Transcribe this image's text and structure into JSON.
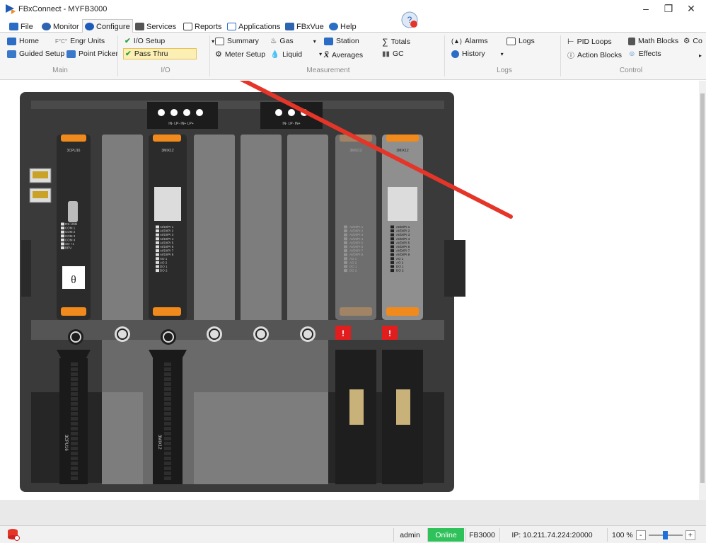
{
  "window": {
    "title": "FBxConnect - MYFB3000"
  },
  "tabs": [
    {
      "label": "File"
    },
    {
      "label": "Monitor"
    },
    {
      "label": "Configure"
    },
    {
      "label": "Services"
    },
    {
      "label": "Reports"
    },
    {
      "label": "Applications"
    },
    {
      "label": "FBxVue"
    },
    {
      "label": "Help"
    }
  ],
  "ribbon": {
    "main": {
      "home": "Home",
      "engr_units": "Engr Units",
      "guided_setup": "Guided Setup",
      "point_picker": "Point Picker",
      "group": "Main"
    },
    "io": {
      "io_setup": "I/O Setup",
      "pass_thru": "Pass Thru",
      "group": "I/O"
    },
    "measurement": {
      "summary": "Summary",
      "meter_setup": "Meter Setup",
      "gas": "Gas",
      "liquid": "Liquid",
      "station": "Station",
      "averages": "Averages",
      "totals": "Totals",
      "gc": "GC",
      "group": "Measurement"
    },
    "logs": {
      "alarms": "Alarms",
      "history": "History",
      "logs": "Logs",
      "group": "Logs"
    },
    "control": {
      "pid_loops": "PID Loops",
      "action_blocks": "Action Blocks",
      "math_blocks": "Math Blocks",
      "effects": "Effects",
      "co": "Co",
      "group": "Control"
    }
  },
  "device": {
    "top_connectors": [
      {
        "label": "IN-  LP-  IN+  LP+"
      },
      {
        "label": "IN-  LP-  IN+"
      }
    ],
    "modules": [
      {
        "name": "3CPU16",
        "bottom_label": "3CPU16",
        "lines": [
          "RS-USB",
          "COM 1",
          "COM 2",
          "COM 3",
          "COM 4",
          "SO +1",
          "BEV-"
        ]
      },
      {
        "name": "3MIX12",
        "bottom_label": "3MIX12",
        "lines": [
          "AI/DI/PI 1",
          "AI/DI/PI 2",
          "AI/DI/PI 3",
          "AI/DI/PI 4",
          "AI/DI/PI 5",
          "AI/DI/PI 6",
          "AI/DI/PI 7",
          "AI/DI/PI 8",
          "AO 1",
          "AO 2",
          "DO 1",
          "DO 2"
        ]
      },
      {
        "name": "3MIX12",
        "lines": [
          "AI/DI/PI 1",
          "AI/DI/PI 2",
          "AI/DI/PI 3",
          "AI/DI/PI 4",
          "AI/DI/PI 5",
          "AI/DI/PI 6",
          "AI/DI/PI 7",
          "AI/DI/PI 8",
          "AO 1",
          "AO 2",
          "DO 1",
          "DO 2"
        ]
      },
      {
        "name": "3MIX12",
        "lines": [
          "AI/DI/PI 1",
          "AI/DI/PI 2",
          "AI/DI/PI 3",
          "AI/DI/PI 4",
          "AI/DI/PI 5",
          "AI/DI/PI 6",
          "AI/DI/PI 7",
          "AI/DI/PI 8",
          "AO 1",
          "AO 2",
          "DO 1",
          "DO 2"
        ]
      }
    ],
    "alert_badges": [
      "!",
      "!"
    ]
  },
  "status": {
    "user": "admin",
    "connection": "Online",
    "device": "FB3000",
    "ip": "IP: 10.211.74.224:20000",
    "zoom": "100 %",
    "zoom_minus": "-",
    "zoom_plus": "+"
  },
  "colors": {
    "accent_orange": "#f08a1c",
    "online_green": "#2fc15a",
    "arrow_red": "#e53529",
    "alert_red": "#e11d1d"
  }
}
